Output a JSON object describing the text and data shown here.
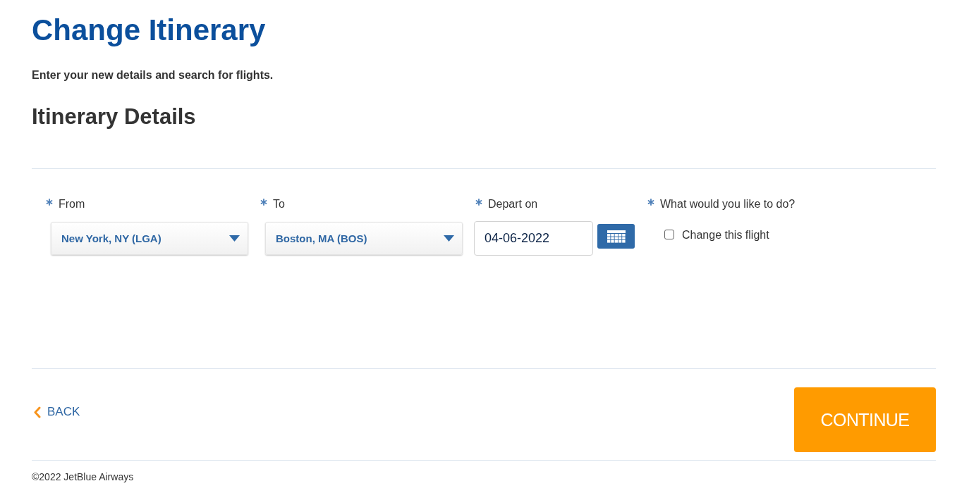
{
  "page": {
    "title": "Change Itinerary",
    "intro": "Enter your new details and search for flights."
  },
  "section": {
    "title": "Itinerary Details"
  },
  "fields": [
    {
      "kind": "select",
      "label": "From",
      "required": true,
      "value": "New York, NY (LGA)"
    },
    {
      "kind": "select",
      "label": "To",
      "required": true,
      "value": "Boston, MA (BOS)"
    },
    {
      "kind": "date",
      "label": "Depart on",
      "required": true,
      "value": "04-06-2022"
    },
    {
      "kind": "checkbox",
      "label": "What would you like to do?",
      "required": true,
      "options": [
        {
          "label": "Change this flight",
          "checked": false
        }
      ]
    }
  ],
  "actions": {
    "back": "BACK",
    "continue": "CONTINUE"
  },
  "footer": {
    "copyright": "©2022 JetBlue Airways"
  }
}
